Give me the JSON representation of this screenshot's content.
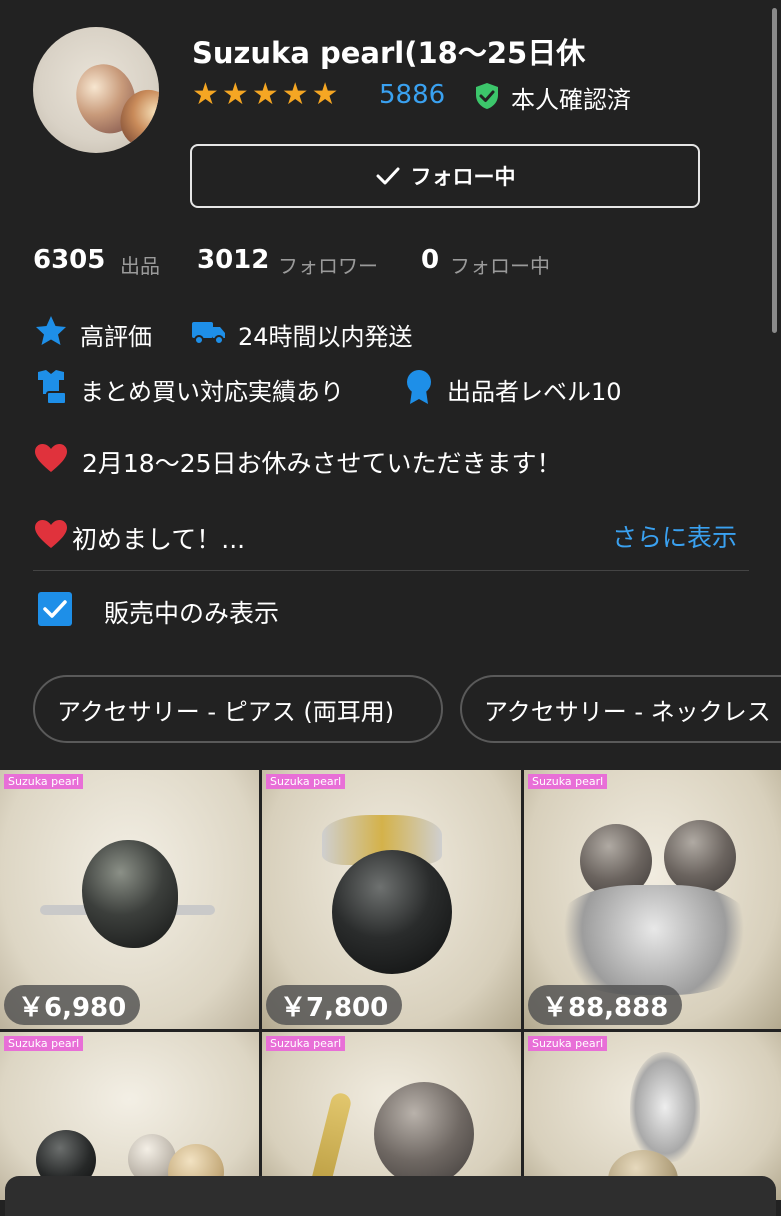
{
  "shop": {
    "name": "Suzuka pearl(18～25日休",
    "rating_count": "5886",
    "verified_label": "本人確認済",
    "follow_button_label": "フォロー中"
  },
  "stats": {
    "listings_count": "6305",
    "listings_label": "出品",
    "followers_count": "3012",
    "followers_label": "フォロワー",
    "following_count": "0",
    "following_label": "フォロー中"
  },
  "badges": {
    "high_rating": "高評価",
    "shipping": "24時間以内発送",
    "bulk": "まとめ買い対応実績あり",
    "seller_level": "出品者レベル10"
  },
  "notice": "2月18～25日お休みさせていただきます！",
  "intro": "初めまして！...",
  "show_more": "さらに表示",
  "filter": {
    "label": "販売中のみ表示",
    "checked": true
  },
  "categories": [
    "アクセサリー - ピアス (両耳用)",
    "アクセサリー - ネックレス"
  ],
  "products": [
    {
      "tag": "Suzuka pearl",
      "price": "￥6,980"
    },
    {
      "tag": "Suzuka pearl",
      "price": "￥7,800"
    },
    {
      "tag": "Suzuka pearl",
      "price": "￥88,888"
    },
    {
      "tag": "Suzuka pearl",
      "price": ""
    },
    {
      "tag": "Suzuka pearl",
      "price": ""
    },
    {
      "tag": "Suzuka pearl",
      "price": ""
    }
  ],
  "colors": {
    "background": "#222222",
    "accent_blue": "#3aa1f0",
    "star": "#f5a623",
    "verified_green": "#3cc66b",
    "heart_red": "#e0323c",
    "tag_pink": "#e86fd7"
  }
}
